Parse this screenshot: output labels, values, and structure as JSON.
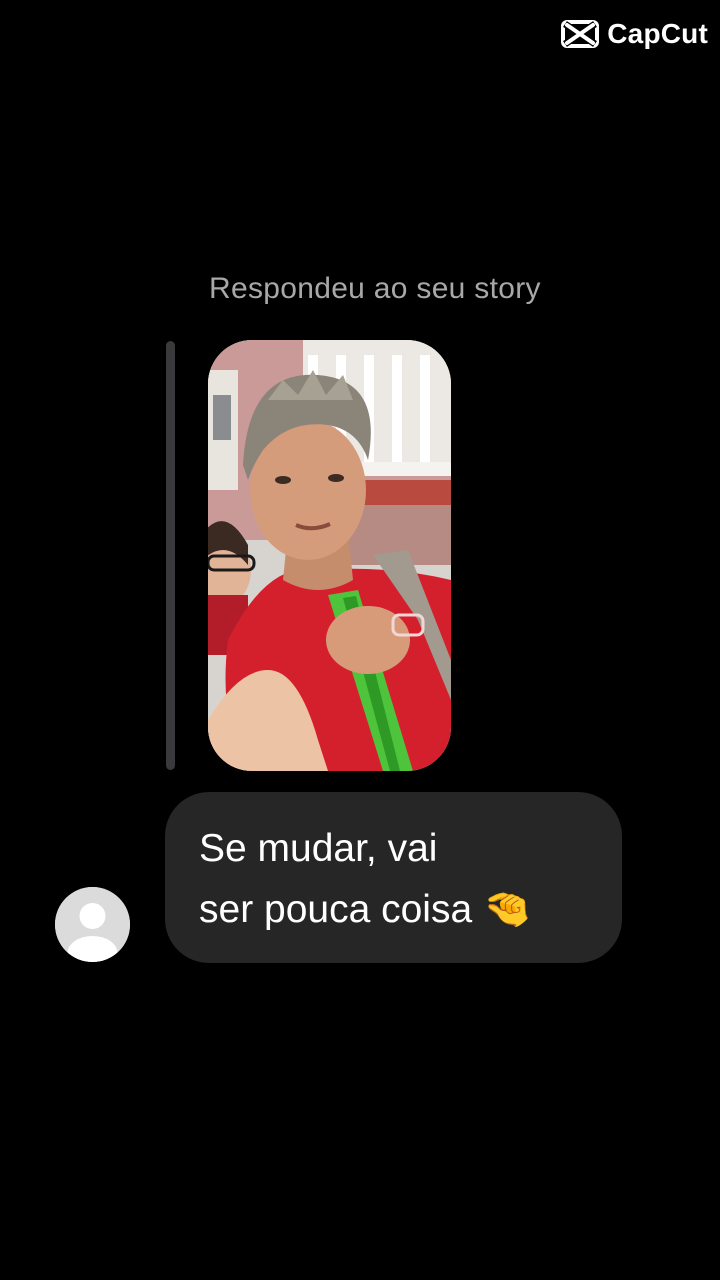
{
  "watermark": {
    "brand": "CapCut",
    "icon": "capcut-logo-icon"
  },
  "story_reply": {
    "label": "Respondeu ao seu story",
    "thumbnail": "story-photo"
  },
  "message": {
    "line1": "Se mudar, vai",
    "line2": "ser pouca coisa",
    "emoji": "🤏"
  },
  "sender": {
    "avatar": "default-avatar-icon"
  },
  "colors": {
    "background": "#000000",
    "bubble": "#262626",
    "label": "#a8a8a8",
    "quote_bar": "#3a3a3c",
    "avatar": "#dbdbdb"
  }
}
